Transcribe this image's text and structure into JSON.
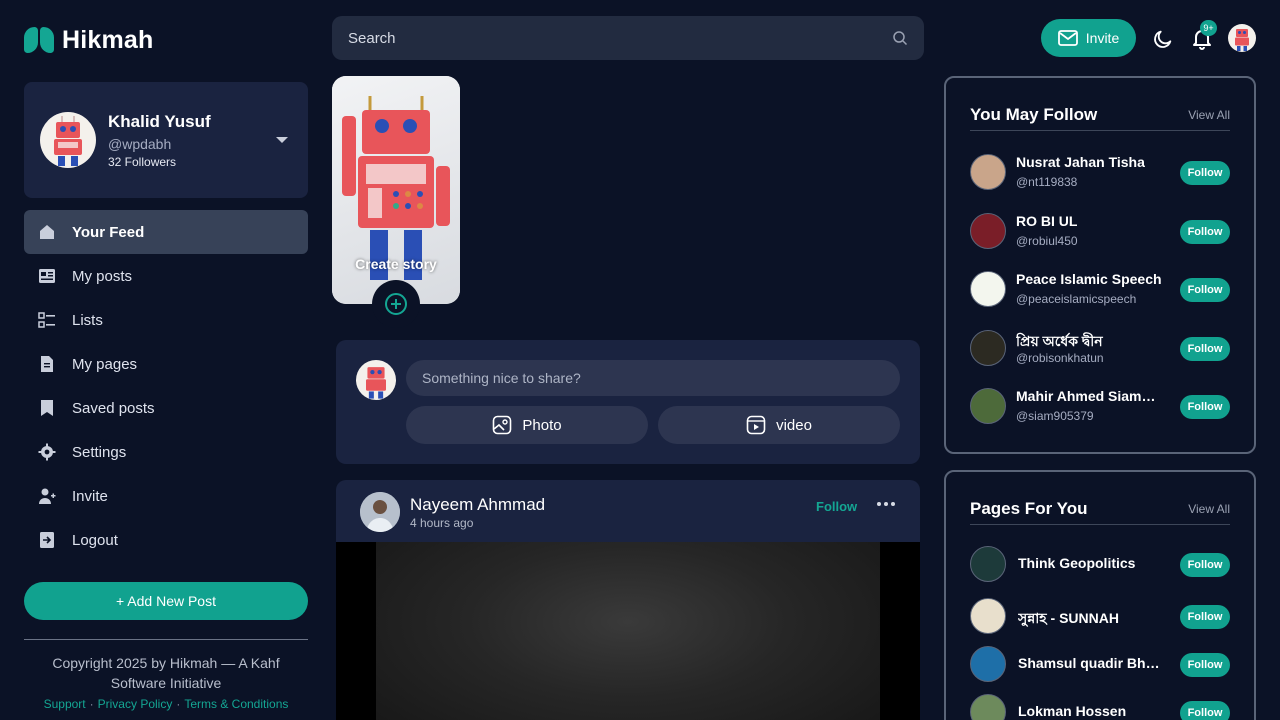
{
  "brand": {
    "name": "Hikmah",
    "accent": "#11a28f"
  },
  "header": {
    "search_placeholder": "Search",
    "invite_label": "Invite",
    "notification_count": "9+"
  },
  "profile": {
    "name": "Khalid Yusuf",
    "handle": "@wpdabh",
    "followers": "32 Followers"
  },
  "nav": [
    {
      "label": "Your Feed",
      "icon": "home-icon",
      "active": true
    },
    {
      "label": "My posts",
      "icon": "posts-icon"
    },
    {
      "label": "Lists",
      "icon": "list-icon"
    },
    {
      "label": "My pages",
      "icon": "page-icon"
    },
    {
      "label": "Saved posts",
      "icon": "bookmark-icon"
    },
    {
      "label": "Settings",
      "icon": "gear-icon"
    },
    {
      "label": "Invite",
      "icon": "add-user-icon"
    },
    {
      "label": "Logout",
      "icon": "logout-icon"
    }
  ],
  "sidebar": {
    "add_post_label": "+ Add New Post",
    "copyright": "Copyright 2025 by Hikmah — A Kahf Software Initiative",
    "links": [
      "Support",
      "Privacy Policy",
      "Terms & Conditions"
    ]
  },
  "story": {
    "label": "Create story"
  },
  "composer": {
    "placeholder": "Something nice to share?",
    "photo_label": "Photo",
    "video_label": "video"
  },
  "post": {
    "author": "Nayeem Ahmmad",
    "time": "4 hours ago",
    "follow_label": "Follow"
  },
  "you_may_follow": {
    "title": "You May Follow",
    "view_all": "View All",
    "follow_label": "Follow",
    "items": [
      {
        "name": "Nusrat Jahan Tisha",
        "handle": "@nt119838"
      },
      {
        "name": "RO BI UL",
        "handle": "@robiul450"
      },
      {
        "name": "Peace Islamic Speech",
        "handle": "@peaceislamicspeech"
      },
      {
        "name": "প্রিয় অর্ধেক দ্বীন",
        "handle": "@robisonkhatun"
      },
      {
        "name": "Mahir Ahmed Siam…",
        "handle": "@siam905379"
      }
    ]
  },
  "pages_for_you": {
    "title": "Pages For You",
    "view_all": "View All",
    "follow_label": "Follow",
    "items": [
      {
        "name": "Think Geopolitics"
      },
      {
        "name": "সুন্নাহ - SUNNAH"
      },
      {
        "name": "Shamsul quadir Bh…"
      },
      {
        "name": "Lokman Hossen"
      }
    ]
  }
}
